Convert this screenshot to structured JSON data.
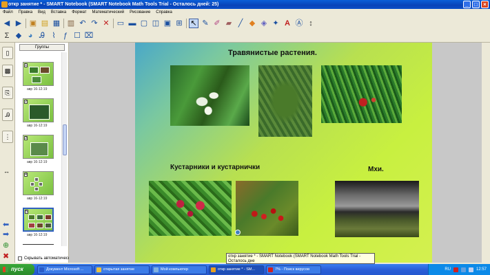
{
  "window": {
    "title": "откр занятие * - SMART Notebook (SMART Notebook Math Tools Trial - Осталось дней: 25)",
    "buttons": [
      "_",
      "□",
      "×"
    ]
  },
  "menu": [
    "Файл",
    "Правка",
    "Вид",
    "Вставка",
    "Формат",
    "Математический",
    "Рисование",
    "Справка"
  ],
  "toolbar": {
    "row1": [
      "back-icon",
      "forward-icon",
      "add-page-icon",
      "open-icon",
      "save-icon",
      "paste-icon",
      "undo-icon",
      "redo-icon",
      "delete-icon",
      "screen-shade-icon",
      "display-icon",
      "capture-icon",
      "capture-area-icon",
      "document-camera-icon",
      "table-icon",
      "select-icon",
      "pen-icon",
      "creative-pen-icon",
      "eraser-icon",
      "line-icon",
      "shape-icon",
      "fill-icon",
      "properties-icon",
      "text-icon",
      "highlight-icon",
      "more-icon"
    ],
    "row2": [
      "sum-icon",
      "graph-icon",
      "3d-icon",
      "handwriting-icon",
      "measure-icon",
      "spell-icon",
      "edit-icon",
      "crop-icon"
    ]
  },
  "sorter": {
    "groups_button": "Группы",
    "thumbs": [
      {
        "label": "авр 16-12:19"
      },
      {
        "label": "авр 16-12:19"
      },
      {
        "label": "авр 16-12:19"
      },
      {
        "label": "авр 16-12:19"
      },
      {
        "label": "авр 16-12:19"
      }
    ],
    "autohide": "Скрывать автоматически"
  },
  "slide": {
    "title_grass": "Травянистые растения.",
    "title_shrubs": "Кустарники и кустарнички",
    "title_moss": "Мхи."
  },
  "tooltip": "откр занятие * - SMART Notebook (SMART Notebook Math Tools Trial - Осталось дне",
  "taskbar": {
    "start": "пуск",
    "tasks": [
      {
        "label": "Документ Microsoft ...",
        "color": "#2a5cc8"
      },
      {
        "label": "открытая занятие",
        "color": "#e8c040"
      },
      {
        "label": "Мой компьютер",
        "color": "#80b0e0"
      },
      {
        "label": "откр занятие * - SM...",
        "color": "#e8a020"
      },
      {
        "label": "7% - Поиск вирусов",
        "color": "#d02020"
      }
    ],
    "lang": "RU",
    "clock": "12:57"
  }
}
